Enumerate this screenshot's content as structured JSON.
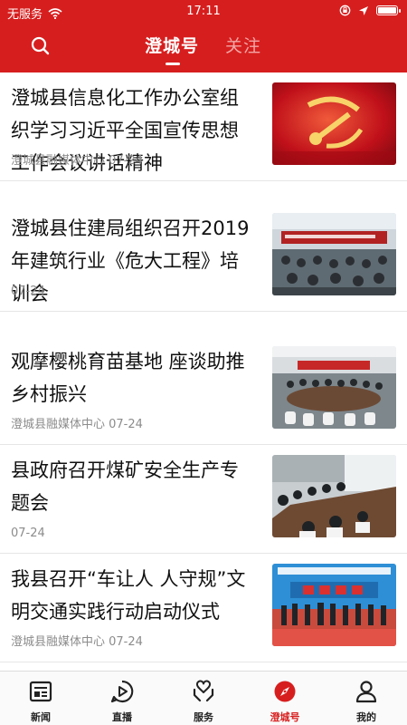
{
  "status_bar": {
    "carrier": "无服务",
    "time": "17:11"
  },
  "header": {
    "search_icon": "search-icon",
    "tabs": [
      {
        "label": "澄城号",
        "active": true
      },
      {
        "label": "关注",
        "active": false
      }
    ]
  },
  "feed": {
    "items": [
      {
        "title": "澄城县信息化工作办公室组织学习习近平全国宣传思想工作会议讲话精神",
        "source": "澄城县融媒体中心",
        "date": "07-24",
        "meta": "澄城县融媒体中心 07-24"
      },
      {
        "title": "澄城县住建局组织召开2019年建筑行业《危大工程》培训会",
        "source": "",
        "date": "07-24",
        "meta": "07-24"
      },
      {
        "title": "观摩樱桃育苗基地 座谈助推乡村振兴",
        "source": "澄城县融媒体中心",
        "date": "07-24",
        "meta": "澄城县融媒体中心 07-24"
      },
      {
        "title": "县政府召开煤矿安全生产专题会",
        "source": "",
        "date": "07-24",
        "meta": "07-24"
      },
      {
        "title": "我县召开“车让人 人守规”文明交通实践行动启动仪式",
        "source": "澄城县融媒体中心",
        "date": "07-24",
        "meta": "澄城县融媒体中心 07-24"
      }
    ]
  },
  "tabbar": {
    "items": [
      {
        "label": "新闻",
        "icon": "news-icon",
        "active": false
      },
      {
        "label": "直播",
        "icon": "play-icon",
        "active": false
      },
      {
        "label": "服务",
        "icon": "heart-hands-icon",
        "active": false
      },
      {
        "label": "澄城号",
        "icon": "compass-icon",
        "active": true
      },
      {
        "label": "我的",
        "icon": "person-icon",
        "active": false
      }
    ]
  },
  "colors": {
    "brand_red": "#d71e1e",
    "inactive_tab": "#f2a6a6",
    "meta_gray": "#8c8c8c"
  }
}
